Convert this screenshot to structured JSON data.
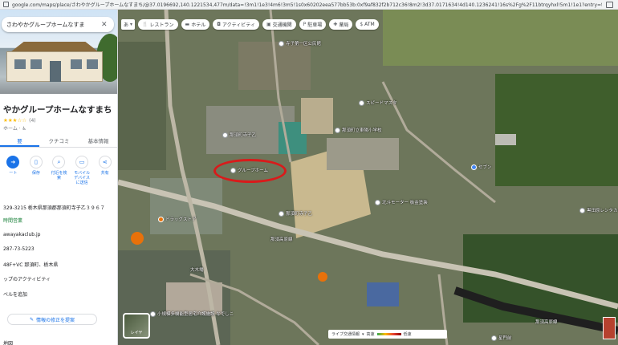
{
  "browser": {
    "url": "google.com/maps/place/さわやかグループホームなすまち/@37.0196692,140.1221534,477m/data=!3m1!1e3!4m6!3m5!1s0x60202eea577bb53b:0xf9af832f2b712c36!8m2!3d37.0171634!4d140.1236241!16s%2Fg%2F11btrqyhxl!5m1!1e1?entry=ttu&g_ep=Egoy..."
  },
  "panel": {
    "search_value": "さわやかグループホームなすま",
    "title": "やかグループホームなすまち",
    "rating_stars": "★★★☆☆",
    "rating_count": "(4)",
    "category": "ホーム · ♿",
    "tabs": [
      {
        "label": "要"
      },
      {
        "label": "クチコミ"
      },
      {
        "label": "基本情報"
      }
    ],
    "actions": [
      {
        "label": "ート",
        "icon": "directions-icon"
      },
      {
        "label": "保存",
        "icon": "bookmark-icon"
      },
      {
        "label": "付近を検索",
        "icon": "nearby-icon"
      },
      {
        "label": "モバイルデバイスに送信",
        "icon": "phone-icon"
      },
      {
        "label": "共有",
        "icon": "share-icon"
      }
    ],
    "address": "329-3215 栃木県那須郡那須町寺子乙３９６７",
    "hours": "時間営業",
    "website": "awayakaclub.jp",
    "phone": "287-73-5223",
    "plus_code": "48F+VC 那須町、栃木県",
    "activity": "ップのアクティビティ",
    "add_label": "ベルを追加",
    "edit_button": "情報の修正を提案",
    "footer": "地図"
  },
  "map": {
    "chips": [
      {
        "label": "あ",
        "icon": "language-icon"
      },
      {
        "label": "レストラン",
        "icon": "restaurant-icon"
      },
      {
        "label": "ホテル",
        "icon": "hotel-icon"
      },
      {
        "label": "アクティビティ",
        "icon": "camera-icon"
      },
      {
        "label": "交通機関",
        "icon": "transit-icon"
      },
      {
        "label": "駐車場",
        "icon": "parking-icon"
      },
      {
        "label": "薬局",
        "icon": "pharmacy-icon"
      },
      {
        "label": "ATM",
        "icon": "atm-icon"
      }
    ],
    "labels": {
      "kominkan": "寺子公民館",
      "speed": "スピードマスタ",
      "school": "那須町立東陽小学校",
      "hanbai": "那須町寺子乙",
      "kiyoshi": "那須町寺子乙",
      "grouphome": "グループホーム",
      "pharmacy": "ドラッグストア",
      "motor": "北斗モーター 板金塗装",
      "rent": "黒田原レンタカー",
      "shop": "セブン",
      "kaigo": "小規模多機能型居宅介護施設 なでしこ",
      "road1": "那須高原線",
      "road2": "大木場",
      "road3": "那須高原線",
      "station": "星門前",
      "school_sign": "寺子第一区公民館"
    },
    "layer_label": "レイヤ",
    "traffic_title": "ライブ交通情報",
    "traffic_fast": "高速",
    "traffic_slow": "低速"
  }
}
